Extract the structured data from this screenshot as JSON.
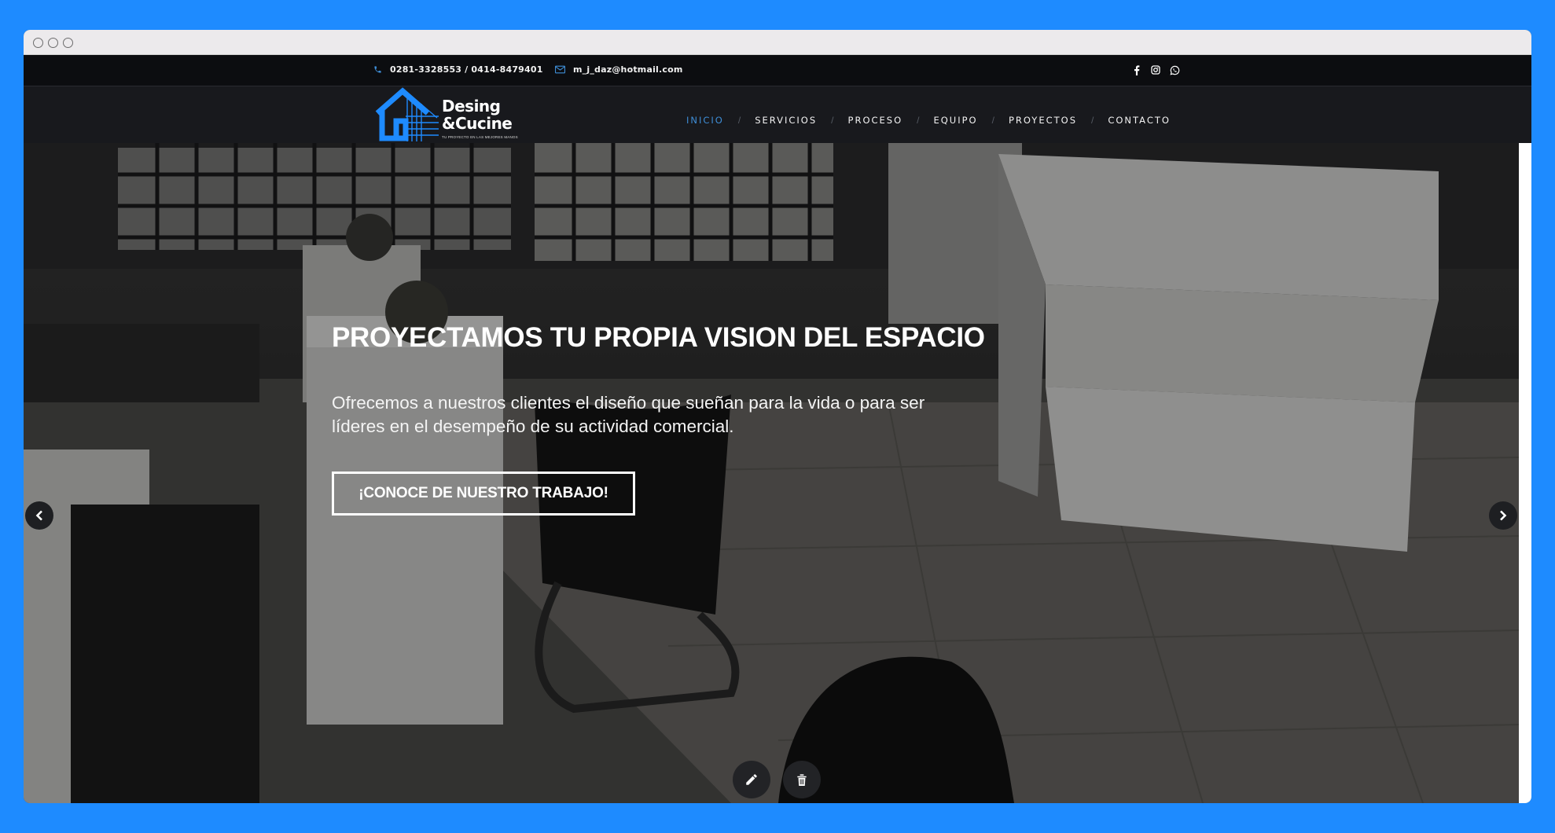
{
  "topbar": {
    "phones": "0281-3328553 / 0414-8479401",
    "email": "m_j_daz@hotmail.com",
    "social": [
      "facebook-icon",
      "instagram-icon",
      "whatsapp-icon"
    ]
  },
  "logo": {
    "line1": "Desing",
    "line2": "&Cucine",
    "tagline": "TU PROYECTO EN LAS MEJORES MANOS"
  },
  "nav": {
    "items": [
      "INICIO",
      "SERVICIOS",
      "PROCESO",
      "EQUIPO",
      "PROYECTOS",
      "CONTACTO"
    ],
    "separator": "/",
    "active_index": 0
  },
  "hero": {
    "title": "PROYECTAMOS TU PROPIA VISION DEL ESPACIO",
    "text": "Ofrecemos a nuestros clientes el diseño que sueñan para la vida o para ser líderes en el desempeño de su actividad comercial.",
    "button": "¡CONOCE DE NUESTRO TRABAJO!"
  },
  "colors": {
    "page_background": "#1e8bff",
    "accent": "#3e8dd6",
    "logo_blue": "#1e8bff"
  }
}
